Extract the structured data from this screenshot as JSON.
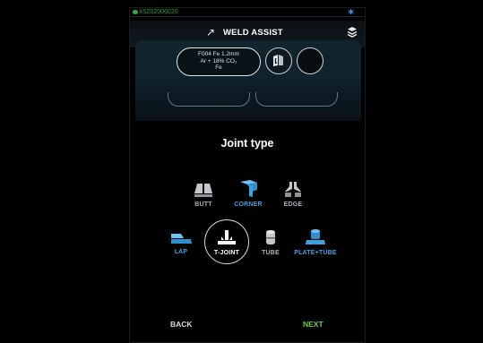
{
  "status": {
    "device_id": "X5202006020"
  },
  "header": {
    "title": "WELD ASSIST",
    "wand_icon": "magic-wand-icon",
    "layers_icon": "layers-icon"
  },
  "setup": {
    "material_line1": "F004 Fe 1.2mm",
    "material_line2": "Ar + 18% CO₂",
    "material_line3": "Fe",
    "wire_icon": "wire-spool-icon"
  },
  "joint": {
    "title": "Joint type",
    "options": [
      {
        "label": "BUTT",
        "state": "available"
      },
      {
        "label": "CORNER",
        "state": "highlighted"
      },
      {
        "label": "EDGE",
        "state": "available"
      },
      {
        "label": "LAP",
        "state": "highlighted"
      },
      {
        "label": "T-JOINT",
        "state": "selected"
      },
      {
        "label": "TUBE",
        "state": "available"
      },
      {
        "label": "PLATE+TUBE",
        "state": "highlighted"
      }
    ]
  },
  "footer": {
    "back_label": "BACK",
    "next_label": "NEXT"
  },
  "colors": {
    "accent_blue": "#3ea1e0",
    "next_green": "#6ed14a",
    "status_green": "#3c9a45"
  }
}
